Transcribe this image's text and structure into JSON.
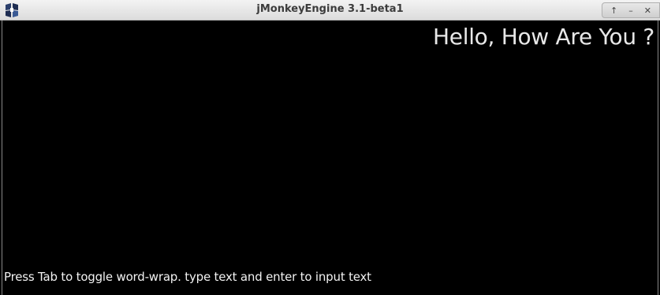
{
  "window": {
    "title": "jMonkeyEngine 3.1-beta1"
  },
  "titlebar_buttons": {
    "maximize_glyph": "↑",
    "minimize_glyph": "–",
    "close_glyph": "✕"
  },
  "scene": {
    "hello_text": "Hello, How Are You ?",
    "hint_text": "Press Tab to toggle word-wrap. type text and enter to input text"
  },
  "colors": {
    "background": "#000000",
    "text": "#e8e8e8"
  }
}
